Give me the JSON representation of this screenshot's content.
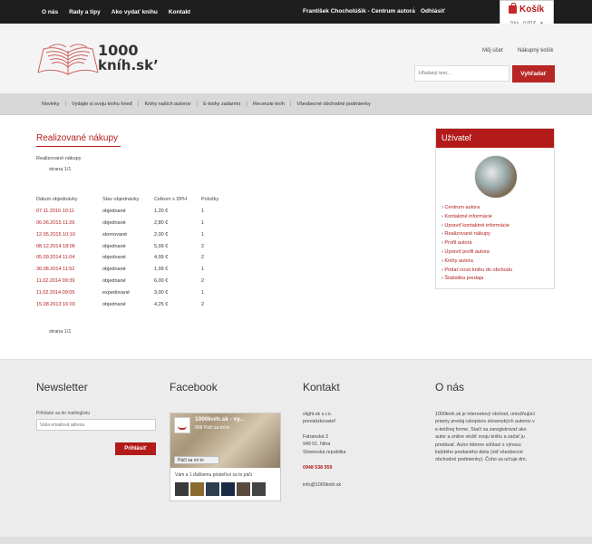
{
  "topnav": {
    "items": [
      "O nás",
      "Rady a tipy",
      "Ako vydať knihu",
      "Kontakt"
    ],
    "author_label": "František Chocholúšik - Centrum autora",
    "separator": "/",
    "logout": "Odhlásiť"
  },
  "cart": {
    "title": "Košík",
    "count": "0 ks",
    "total": "0,00 €",
    "chevron": "▾",
    "icon": "bag-icon"
  },
  "header": {
    "logo_1000": "1000",
    "logo_knih": "kníh.sk’",
    "my_account": "Môj účet",
    "shopping_cart": "Nákupný košík",
    "search_placeholder": "Hľadaný text...",
    "search_button": "Vyhľadať"
  },
  "categories": [
    "Novinky",
    "Vydajte si svoju knihu hneď",
    "Knihy našich autorov",
    "E-knihy zadarmo",
    "Recenzie kníh",
    "Všeobecné obchodné podmienky"
  ],
  "main": {
    "title": "Realizované nákupy",
    "breadcrumb": "Realizované nákupy",
    "pager_top": "strana 1/1",
    "pager_bottom": "strana 1/1",
    "table": {
      "headers": [
        "Dátum objednávky",
        "Stav objednávky",
        "Celkom s DPH",
        "Položky"
      ],
      "rows": [
        [
          "07.11.2016 10:11",
          "objednané",
          "1,20 €",
          "1"
        ],
        [
          "06.06.2015 11:26",
          "objednané",
          "2,80 €",
          "1"
        ],
        [
          "12.05.2015 10:10",
          "stornované",
          "2,00 €",
          "1"
        ],
        [
          "08.12.2014 18:06",
          "objednané",
          "5,99 €",
          "2"
        ],
        [
          "05.09.2014 11:04",
          "objednané",
          "4,99 €",
          "2"
        ],
        [
          "30.08.2014 11:52",
          "objednané",
          "1,99 €",
          "1"
        ],
        [
          "11.02.2014 09:39",
          "objednané",
          "6,00 €",
          "2"
        ],
        [
          "11.02.2014 09:05",
          "expedované",
          "3,00 €",
          "1"
        ],
        [
          "15.08.2013 16:03",
          "objednané",
          "4,25 €",
          "2"
        ]
      ]
    }
  },
  "user_panel": {
    "title": "Užívateľ",
    "menu": [
      "Centrum autora",
      "Kontaktné informácie",
      "Upraviť kontaktné informácie",
      "Realizované nákupy",
      "Profil autora",
      "Upraviť profil autora",
      "Knihy autora",
      "Pridať novú knihu do obchodu",
      "Štatistika predaja"
    ]
  },
  "footer": {
    "newsletter": {
      "title": "Newsletter",
      "label": "Prihláste sa do mailinglistu",
      "placeholder": "Vaša emailová adresa",
      "button": "Prihlásiť"
    },
    "facebook": {
      "title": "Facebook",
      "page_name": "1000knih.sk - vy...",
      "likes": "958 Páči sa mi to",
      "like_button": "Páči sa mi to",
      "friends_text": "Vám a 1 ďalšiemu priateľovi sa to páči"
    },
    "contact": {
      "title": "Kontakt",
      "company": "slight.sk s.r.o.",
      "operator": "prevádzkovateľ",
      "street": "Fatranská 3",
      "city": "949 01, Nitra",
      "country": "Slovenská republika",
      "phone": "0948 538 559",
      "email": "info@1000knih.sk"
    },
    "about": {
      "title": "O nás",
      "lines": [
        "1000knih.sk je internetový obchod, umožňujúci",
        "priamy predaj rukopisov slovenských autorov v",
        "e-knižnej forme. Stačí sa zaregistrovať ako",
        "autor a online vložiť svoju knihu a začať ju",
        "predávať. Autor tiderne súhlasí s výnosu",
        "každého predaného diela (viď všeobecné",
        "obchodné podmienky). Čoho sa určuje dm."
      ]
    }
  },
  "colors": {
    "accent": "#b31b1b",
    "topbar": "#1e1e1e"
  }
}
